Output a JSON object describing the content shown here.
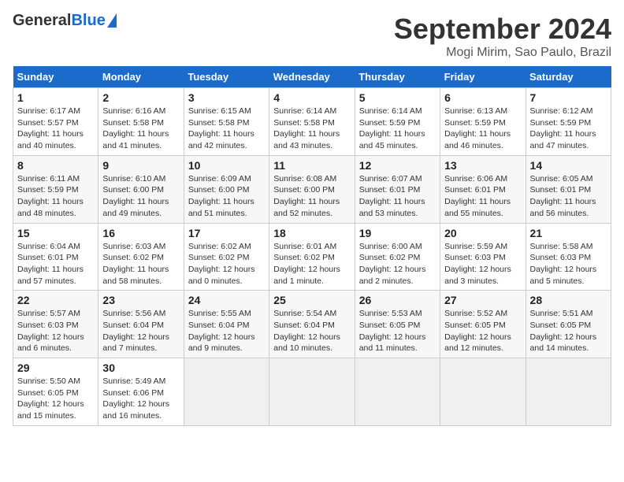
{
  "header": {
    "logo_general": "General",
    "logo_blue": "Blue",
    "main_title": "September 2024",
    "sub_title": "Mogi Mirim, Sao Paulo, Brazil"
  },
  "calendar": {
    "days_of_week": [
      "Sunday",
      "Monday",
      "Tuesday",
      "Wednesday",
      "Thursday",
      "Friday",
      "Saturday"
    ],
    "weeks": [
      [
        {
          "day": "1",
          "lines": [
            "Sunrise: 6:17 AM",
            "Sunset: 5:57 PM",
            "Daylight: 11 hours",
            "and 40 minutes."
          ]
        },
        {
          "day": "2",
          "lines": [
            "Sunrise: 6:16 AM",
            "Sunset: 5:58 PM",
            "Daylight: 11 hours",
            "and 41 minutes."
          ]
        },
        {
          "day": "3",
          "lines": [
            "Sunrise: 6:15 AM",
            "Sunset: 5:58 PM",
            "Daylight: 11 hours",
            "and 42 minutes."
          ]
        },
        {
          "day": "4",
          "lines": [
            "Sunrise: 6:14 AM",
            "Sunset: 5:58 PM",
            "Daylight: 11 hours",
            "and 43 minutes."
          ]
        },
        {
          "day": "5",
          "lines": [
            "Sunrise: 6:14 AM",
            "Sunset: 5:59 PM",
            "Daylight: 11 hours",
            "and 45 minutes."
          ]
        },
        {
          "day": "6",
          "lines": [
            "Sunrise: 6:13 AM",
            "Sunset: 5:59 PM",
            "Daylight: 11 hours",
            "and 46 minutes."
          ]
        },
        {
          "day": "7",
          "lines": [
            "Sunrise: 6:12 AM",
            "Sunset: 5:59 PM",
            "Daylight: 11 hours",
            "and 47 minutes."
          ]
        }
      ],
      [
        {
          "day": "8",
          "lines": [
            "Sunrise: 6:11 AM",
            "Sunset: 5:59 PM",
            "Daylight: 11 hours",
            "and 48 minutes."
          ]
        },
        {
          "day": "9",
          "lines": [
            "Sunrise: 6:10 AM",
            "Sunset: 6:00 PM",
            "Daylight: 11 hours",
            "and 49 minutes."
          ]
        },
        {
          "day": "10",
          "lines": [
            "Sunrise: 6:09 AM",
            "Sunset: 6:00 PM",
            "Daylight: 11 hours",
            "and 51 minutes."
          ]
        },
        {
          "day": "11",
          "lines": [
            "Sunrise: 6:08 AM",
            "Sunset: 6:00 PM",
            "Daylight: 11 hours",
            "and 52 minutes."
          ]
        },
        {
          "day": "12",
          "lines": [
            "Sunrise: 6:07 AM",
            "Sunset: 6:01 PM",
            "Daylight: 11 hours",
            "and 53 minutes."
          ]
        },
        {
          "day": "13",
          "lines": [
            "Sunrise: 6:06 AM",
            "Sunset: 6:01 PM",
            "Daylight: 11 hours",
            "and 55 minutes."
          ]
        },
        {
          "day": "14",
          "lines": [
            "Sunrise: 6:05 AM",
            "Sunset: 6:01 PM",
            "Daylight: 11 hours",
            "and 56 minutes."
          ]
        }
      ],
      [
        {
          "day": "15",
          "lines": [
            "Sunrise: 6:04 AM",
            "Sunset: 6:01 PM",
            "Daylight: 11 hours",
            "and 57 minutes."
          ]
        },
        {
          "day": "16",
          "lines": [
            "Sunrise: 6:03 AM",
            "Sunset: 6:02 PM",
            "Daylight: 11 hours",
            "and 58 minutes."
          ]
        },
        {
          "day": "17",
          "lines": [
            "Sunrise: 6:02 AM",
            "Sunset: 6:02 PM",
            "Daylight: 12 hours",
            "and 0 minutes."
          ]
        },
        {
          "day": "18",
          "lines": [
            "Sunrise: 6:01 AM",
            "Sunset: 6:02 PM",
            "Daylight: 12 hours",
            "and 1 minute."
          ]
        },
        {
          "day": "19",
          "lines": [
            "Sunrise: 6:00 AM",
            "Sunset: 6:02 PM",
            "Daylight: 12 hours",
            "and 2 minutes."
          ]
        },
        {
          "day": "20",
          "lines": [
            "Sunrise: 5:59 AM",
            "Sunset: 6:03 PM",
            "Daylight: 12 hours",
            "and 3 minutes."
          ]
        },
        {
          "day": "21",
          "lines": [
            "Sunrise: 5:58 AM",
            "Sunset: 6:03 PM",
            "Daylight: 12 hours",
            "and 5 minutes."
          ]
        }
      ],
      [
        {
          "day": "22",
          "lines": [
            "Sunrise: 5:57 AM",
            "Sunset: 6:03 PM",
            "Daylight: 12 hours",
            "and 6 minutes."
          ]
        },
        {
          "day": "23",
          "lines": [
            "Sunrise: 5:56 AM",
            "Sunset: 6:04 PM",
            "Daylight: 12 hours",
            "and 7 minutes."
          ]
        },
        {
          "day": "24",
          "lines": [
            "Sunrise: 5:55 AM",
            "Sunset: 6:04 PM",
            "Daylight: 12 hours",
            "and 9 minutes."
          ]
        },
        {
          "day": "25",
          "lines": [
            "Sunrise: 5:54 AM",
            "Sunset: 6:04 PM",
            "Daylight: 12 hours",
            "and 10 minutes."
          ]
        },
        {
          "day": "26",
          "lines": [
            "Sunrise: 5:53 AM",
            "Sunset: 6:05 PM",
            "Daylight: 12 hours",
            "and 11 minutes."
          ]
        },
        {
          "day": "27",
          "lines": [
            "Sunrise: 5:52 AM",
            "Sunset: 6:05 PM",
            "Daylight: 12 hours",
            "and 12 minutes."
          ]
        },
        {
          "day": "28",
          "lines": [
            "Sunrise: 5:51 AM",
            "Sunset: 6:05 PM",
            "Daylight: 12 hours",
            "and 14 minutes."
          ]
        }
      ],
      [
        {
          "day": "29",
          "lines": [
            "Sunrise: 5:50 AM",
            "Sunset: 6:05 PM",
            "Daylight: 12 hours",
            "and 15 minutes."
          ]
        },
        {
          "day": "30",
          "lines": [
            "Sunrise: 5:49 AM",
            "Sunset: 6:06 PM",
            "Daylight: 12 hours",
            "and 16 minutes."
          ]
        },
        {
          "day": "",
          "lines": []
        },
        {
          "day": "",
          "lines": []
        },
        {
          "day": "",
          "lines": []
        },
        {
          "day": "",
          "lines": []
        },
        {
          "day": "",
          "lines": []
        }
      ]
    ]
  }
}
